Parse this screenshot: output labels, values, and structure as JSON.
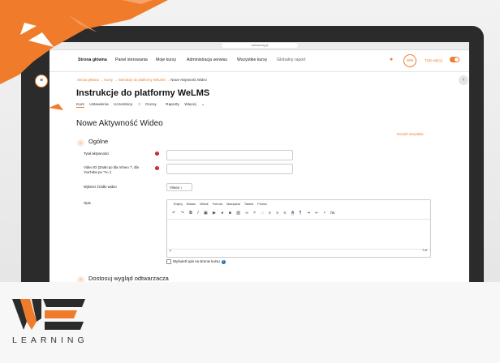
{
  "browser": {
    "url": "welearning.pl"
  },
  "navbar": {
    "items": [
      "Strona główna",
      "Panel sterowania",
      "Moje kursy",
      "Administracja serwisu",
      "Wszystkie kursy",
      "Globalny raport"
    ],
    "avatar_initials": "WW",
    "edit_mode_label": "Tryb edycji"
  },
  "breadcrumb": {
    "home": "Strona główna",
    "courses": "Kursy",
    "course": "Instrukcje do platformy WeLMS",
    "current": "Nowe Aktywność Wideo",
    "separator": "→"
  },
  "course": {
    "title": "Instrukcje do platformy WeLMS",
    "tabs": [
      "Kurs",
      "Ustawienia",
      "Uczestnicy",
      "Oceny",
      "Raporty",
      "Więcej"
    ]
  },
  "page": {
    "title": "Nowe Aktywność Wideo",
    "expand_all": "Rozwiń wszystkie"
  },
  "section_general": {
    "title": "Ogólne",
    "activity_title_label": "Tytuł aktywności",
    "video_id_label": "Video ID (Znaki po dla Vimeo '/', dla YouTube po '?v=')",
    "video_source_label": "Wybierz źródło wideo",
    "video_source_value": "Vimeo",
    "description_label": "Opis",
    "show_description_label": "Wyświetl opis na stronie kursu"
  },
  "editor": {
    "menu": [
      "Edytuj",
      "Wstaw",
      "Widok",
      "Format",
      "Narzędzia",
      "Tabela",
      "Pomoc"
    ],
    "status": "p",
    "words": "0 sł."
  },
  "section_player": {
    "title": "Dostosuj wygląd odtwarzacza"
  },
  "brand": {
    "logo_text": "LEARNING",
    "accent": "#f07b2a",
    "dark": "#2b2b2b"
  }
}
